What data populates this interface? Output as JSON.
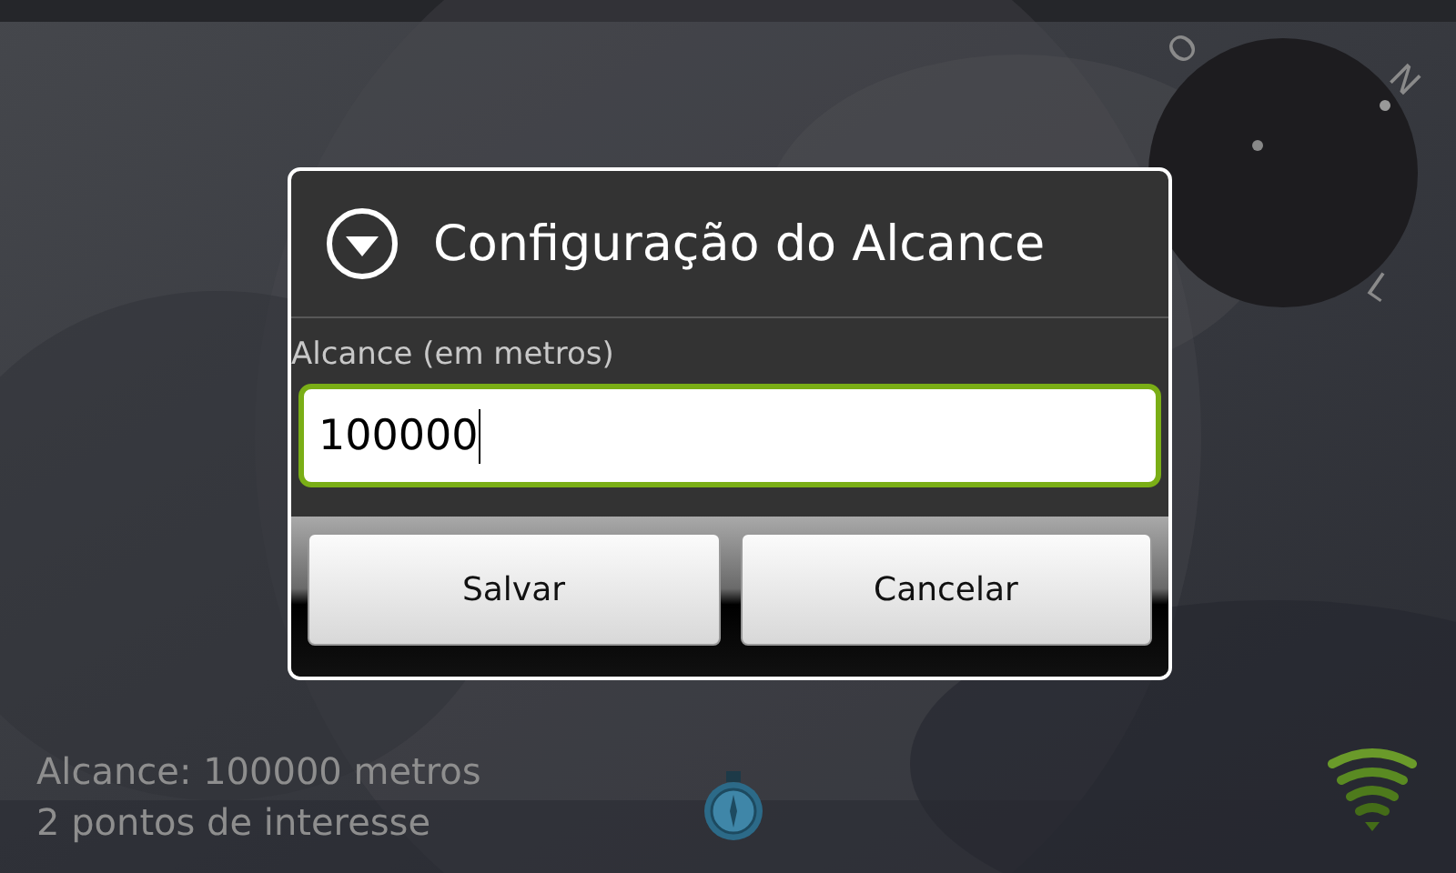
{
  "radar": {
    "labels": [
      "O",
      "N",
      "L"
    ]
  },
  "dialog": {
    "title": "Configuração do Alcance",
    "field": {
      "label": "Alcance (em metros)",
      "value": "100000",
      "focused": true
    },
    "buttons": [
      "Salvar",
      "Cancelar"
    ]
  },
  "status": {
    "lines": [
      "Alcance: 100000 metros",
      "2 pontos de interesse"
    ]
  }
}
